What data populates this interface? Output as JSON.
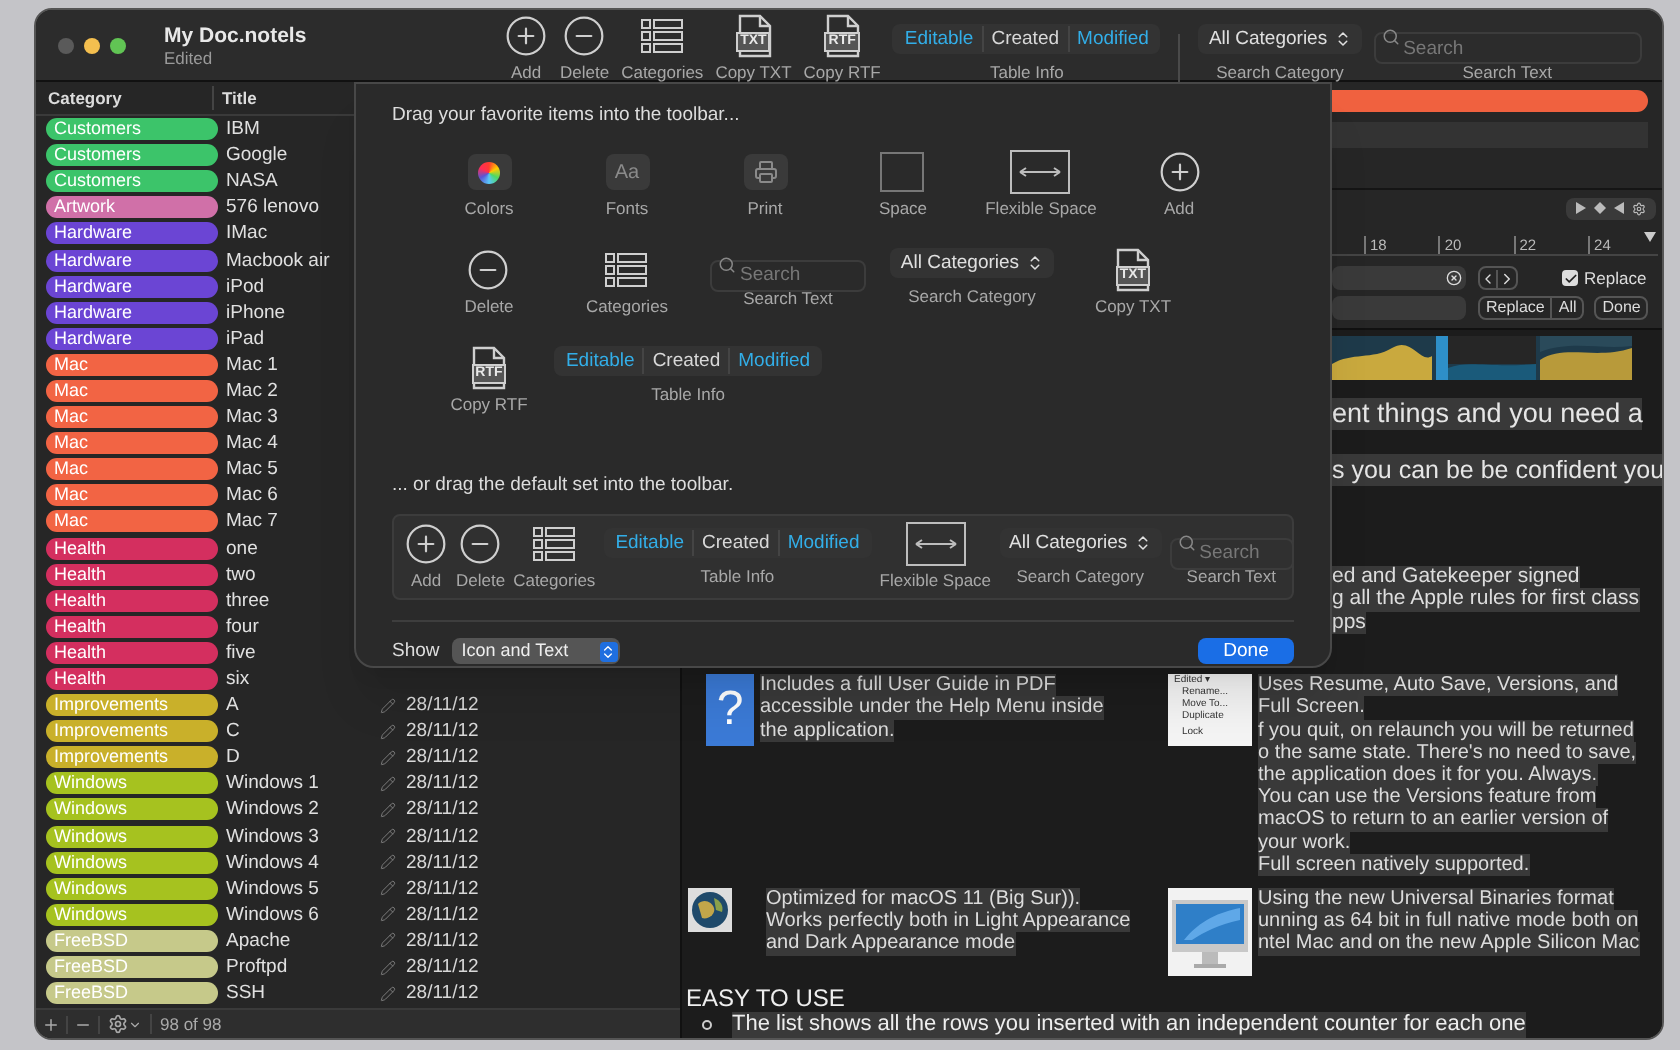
{
  "window": {
    "title": "My Doc.notels",
    "subtitle": "Edited"
  },
  "toolbar": [
    {
      "kind": "add",
      "label": "Add"
    },
    {
      "kind": "delete",
      "label": "Delete"
    },
    {
      "kind": "categories",
      "label": "Categories"
    },
    {
      "kind": "file",
      "badge": "TXT",
      "label": "Copy TXT"
    },
    {
      "kind": "file",
      "badge": "RTF",
      "label": "Copy RTF"
    },
    {
      "kind": "segmented",
      "label": "Table Info",
      "segments": [
        {
          "text": "Editable",
          "selected": true
        },
        {
          "text": "Created",
          "selected": false
        },
        {
          "text": "Modified",
          "selected": true
        }
      ]
    },
    {
      "kind": "separator"
    },
    {
      "kind": "popup",
      "value": "All Categories",
      "label": "Search Category"
    },
    {
      "kind": "search",
      "placeholder": "Search",
      "label": "Search Text"
    }
  ],
  "table": {
    "columns": [
      "Category",
      "Title"
    ],
    "rows": [
      {
        "category": "Customers",
        "color": "#3cc46a",
        "title": "IBM"
      },
      {
        "category": "Customers",
        "color": "#3cc46a",
        "title": "Google"
      },
      {
        "category": "Customers",
        "color": "#3cc46a",
        "title": "NASA"
      },
      {
        "category": "Artwork",
        "color": "#d070a8",
        "title": "576 lenovo"
      },
      {
        "category": "Hardware",
        "color": "#6b45d4",
        "title": "IMac"
      },
      {
        "category": "Hardware",
        "color": "#6b45d4",
        "title": "Macbook air"
      },
      {
        "category": "Hardware",
        "color": "#6b45d4",
        "title": "iPod"
      },
      {
        "category": "Hardware",
        "color": "#6b45d4",
        "title": "iPhone"
      },
      {
        "category": "Hardware",
        "color": "#6b45d4",
        "title": "iPad"
      },
      {
        "category": "Mac",
        "color": "#f26444",
        "title": "Mac 1"
      },
      {
        "category": "Mac",
        "color": "#f26444",
        "title": "Mac 2"
      },
      {
        "category": "Mac",
        "color": "#f26444",
        "title": "Mac 3"
      },
      {
        "category": "Mac",
        "color": "#f26444",
        "title": "Mac 4"
      },
      {
        "category": "Mac",
        "color": "#f26444",
        "title": "Mac 5"
      },
      {
        "category": "Mac",
        "color": "#f26444",
        "title": "Mac 6"
      },
      {
        "category": "Mac",
        "color": "#f26444",
        "title": "Mac 7"
      },
      {
        "category": "Health",
        "color": "#d42f5f",
        "title": "one"
      },
      {
        "category": "Health",
        "color": "#d42f5f",
        "title": "two"
      },
      {
        "category": "Health",
        "color": "#d42f5f",
        "title": "three"
      },
      {
        "category": "Health",
        "color": "#d42f5f",
        "title": "four"
      },
      {
        "category": "Health",
        "color": "#d42f5f",
        "title": "five"
      },
      {
        "category": "Health",
        "color": "#d42f5f",
        "title": "six"
      },
      {
        "category": "Improvements",
        "color": "#c9b02a",
        "title": "A",
        "date": "28/11/12"
      },
      {
        "category": "Improvements",
        "color": "#c9b02a",
        "title": "C",
        "date": "28/11/12"
      },
      {
        "category": "Improvements",
        "color": "#c9b02a",
        "title": "D",
        "date": "28/11/12"
      },
      {
        "category": "Windows",
        "color": "#a6c21f",
        "title": "Windows 1",
        "date": "28/11/12"
      },
      {
        "category": "Windows",
        "color": "#a6c21f",
        "title": "Windows 2",
        "date": "28/11/12"
      },
      {
        "category": "Windows",
        "color": "#a6c21f",
        "title": "Windows 3",
        "date": "28/11/12"
      },
      {
        "category": "Windows",
        "color": "#a6c21f",
        "title": "Windows 4",
        "date": "28/11/12"
      },
      {
        "category": "Windows",
        "color": "#a6c21f",
        "title": "Windows 5",
        "date": "28/11/12"
      },
      {
        "category": "Windows",
        "color": "#a6c21f",
        "title": "Windows 6",
        "date": "28/11/12"
      },
      {
        "category": "FreeBSD",
        "color": "#c6c98a",
        "title": "Apache",
        "date": "28/11/12"
      },
      {
        "category": "FreeBSD",
        "color": "#c6c98a",
        "title": "Proftpd",
        "date": "28/11/12"
      },
      {
        "category": "FreeBSD",
        "color": "#c6c98a",
        "title": "SSH",
        "date": "28/11/12"
      }
    ],
    "count": "98 of 98"
  },
  "editor": {
    "ruler": [
      "18",
      "20",
      "22",
      "24"
    ],
    "find": {
      "replace": {
        "label": "Replace",
        "checked": true
      },
      "buttons": [
        "Replace",
        "All",
        "Done"
      ]
    },
    "lines": [
      "ent things and you need a",
      "s you can be be confident you"
    ],
    "paragraph": [
      "ed and Gatekeeper signed",
      "g all the Apple rules for first class",
      "pps"
    ],
    "features": [
      {
        "kind": "help",
        "glyph": "?",
        "lines": [
          "Includes a full User Guide in PDF",
          "accessible under the Help Menu inside",
          "the application."
        ]
      },
      {
        "kind": "menu",
        "menu": [
          "Edited ▾",
          "Rename...",
          "Move To...",
          "Duplicate",
          "Lock"
        ],
        "lines": [
          "Uses Resume, Auto Save, Versions, and",
          "Full Screen.",
          "f you quit, on relaunch you will be returned",
          "o the same state. There's no need to save,",
          "the application does it for you. Always.",
          "You can use the Versions feature from",
          "macOS to return to an earlier version of",
          "your work.",
          "Full screen natively supported."
        ]
      },
      {
        "kind": "globe",
        "lines": [
          "Optimized for macOS 11 (Big Sur)).",
          "Works perfectly both in Light Appearance",
          "and Dark Appearance mode"
        ]
      },
      {
        "kind": "imac",
        "lines": [
          "Using the new Universal Binaries format",
          "unning as 64 bit in full native mode both on",
          "ntel Mac and on the new Apple Silicon Mac"
        ]
      }
    ],
    "heading": "EASY TO USE",
    "bullets": [
      "The list shows all the rows you inserted with an independent counter for each one"
    ]
  },
  "sheet": {
    "instruction": "Drag your favorite items into the toolbar...",
    "items": [
      {
        "kind": "colors",
        "label": "Colors"
      },
      {
        "kind": "fonts",
        "glyph": "Aa",
        "label": "Fonts"
      },
      {
        "kind": "print",
        "label": "Print"
      },
      {
        "kind": "space",
        "label": "Space"
      },
      {
        "kind": "flexspace",
        "label": "Flexible Space"
      },
      {
        "kind": "add",
        "label": "Add"
      },
      {
        "kind": "delete",
        "label": "Delete"
      },
      {
        "kind": "categories",
        "label": "Categories"
      },
      {
        "kind": "search",
        "placeholder": "Search",
        "label": "Search Text"
      },
      {
        "kind": "popup",
        "value": "All Categories",
        "label": "Search Category"
      },
      {
        "kind": "file",
        "badge": "TXT",
        "label": "Copy TXT"
      },
      {
        "kind": "file",
        "badge": "RTF",
        "label": "Copy RTF"
      },
      {
        "kind": "segmented",
        "label": "Table Info",
        "segments": [
          {
            "text": "Editable",
            "selected": true
          },
          {
            "text": "Created",
            "selected": false
          },
          {
            "text": "Modified",
            "selected": true
          }
        ]
      }
    ],
    "default_instruction": "... or drag the default set into the toolbar.",
    "default_items": [
      {
        "kind": "add",
        "label": "Add"
      },
      {
        "kind": "delete",
        "label": "Delete"
      },
      {
        "kind": "categories",
        "label": "Categories"
      },
      {
        "kind": "segmented",
        "label": "Table Info",
        "segments": [
          {
            "text": "Editable",
            "selected": true
          },
          {
            "text": "Created",
            "selected": false
          },
          {
            "text": "Modified",
            "selected": true
          }
        ]
      },
      {
        "kind": "flexspace",
        "label": "Flexible Space"
      },
      {
        "kind": "popup",
        "value": "All Categories",
        "label": "Search Category"
      },
      {
        "kind": "search",
        "placeholder": "Search",
        "label": "Search Text"
      }
    ],
    "show_label": "Show",
    "show_value": "Icon and Text",
    "done": "Done"
  }
}
